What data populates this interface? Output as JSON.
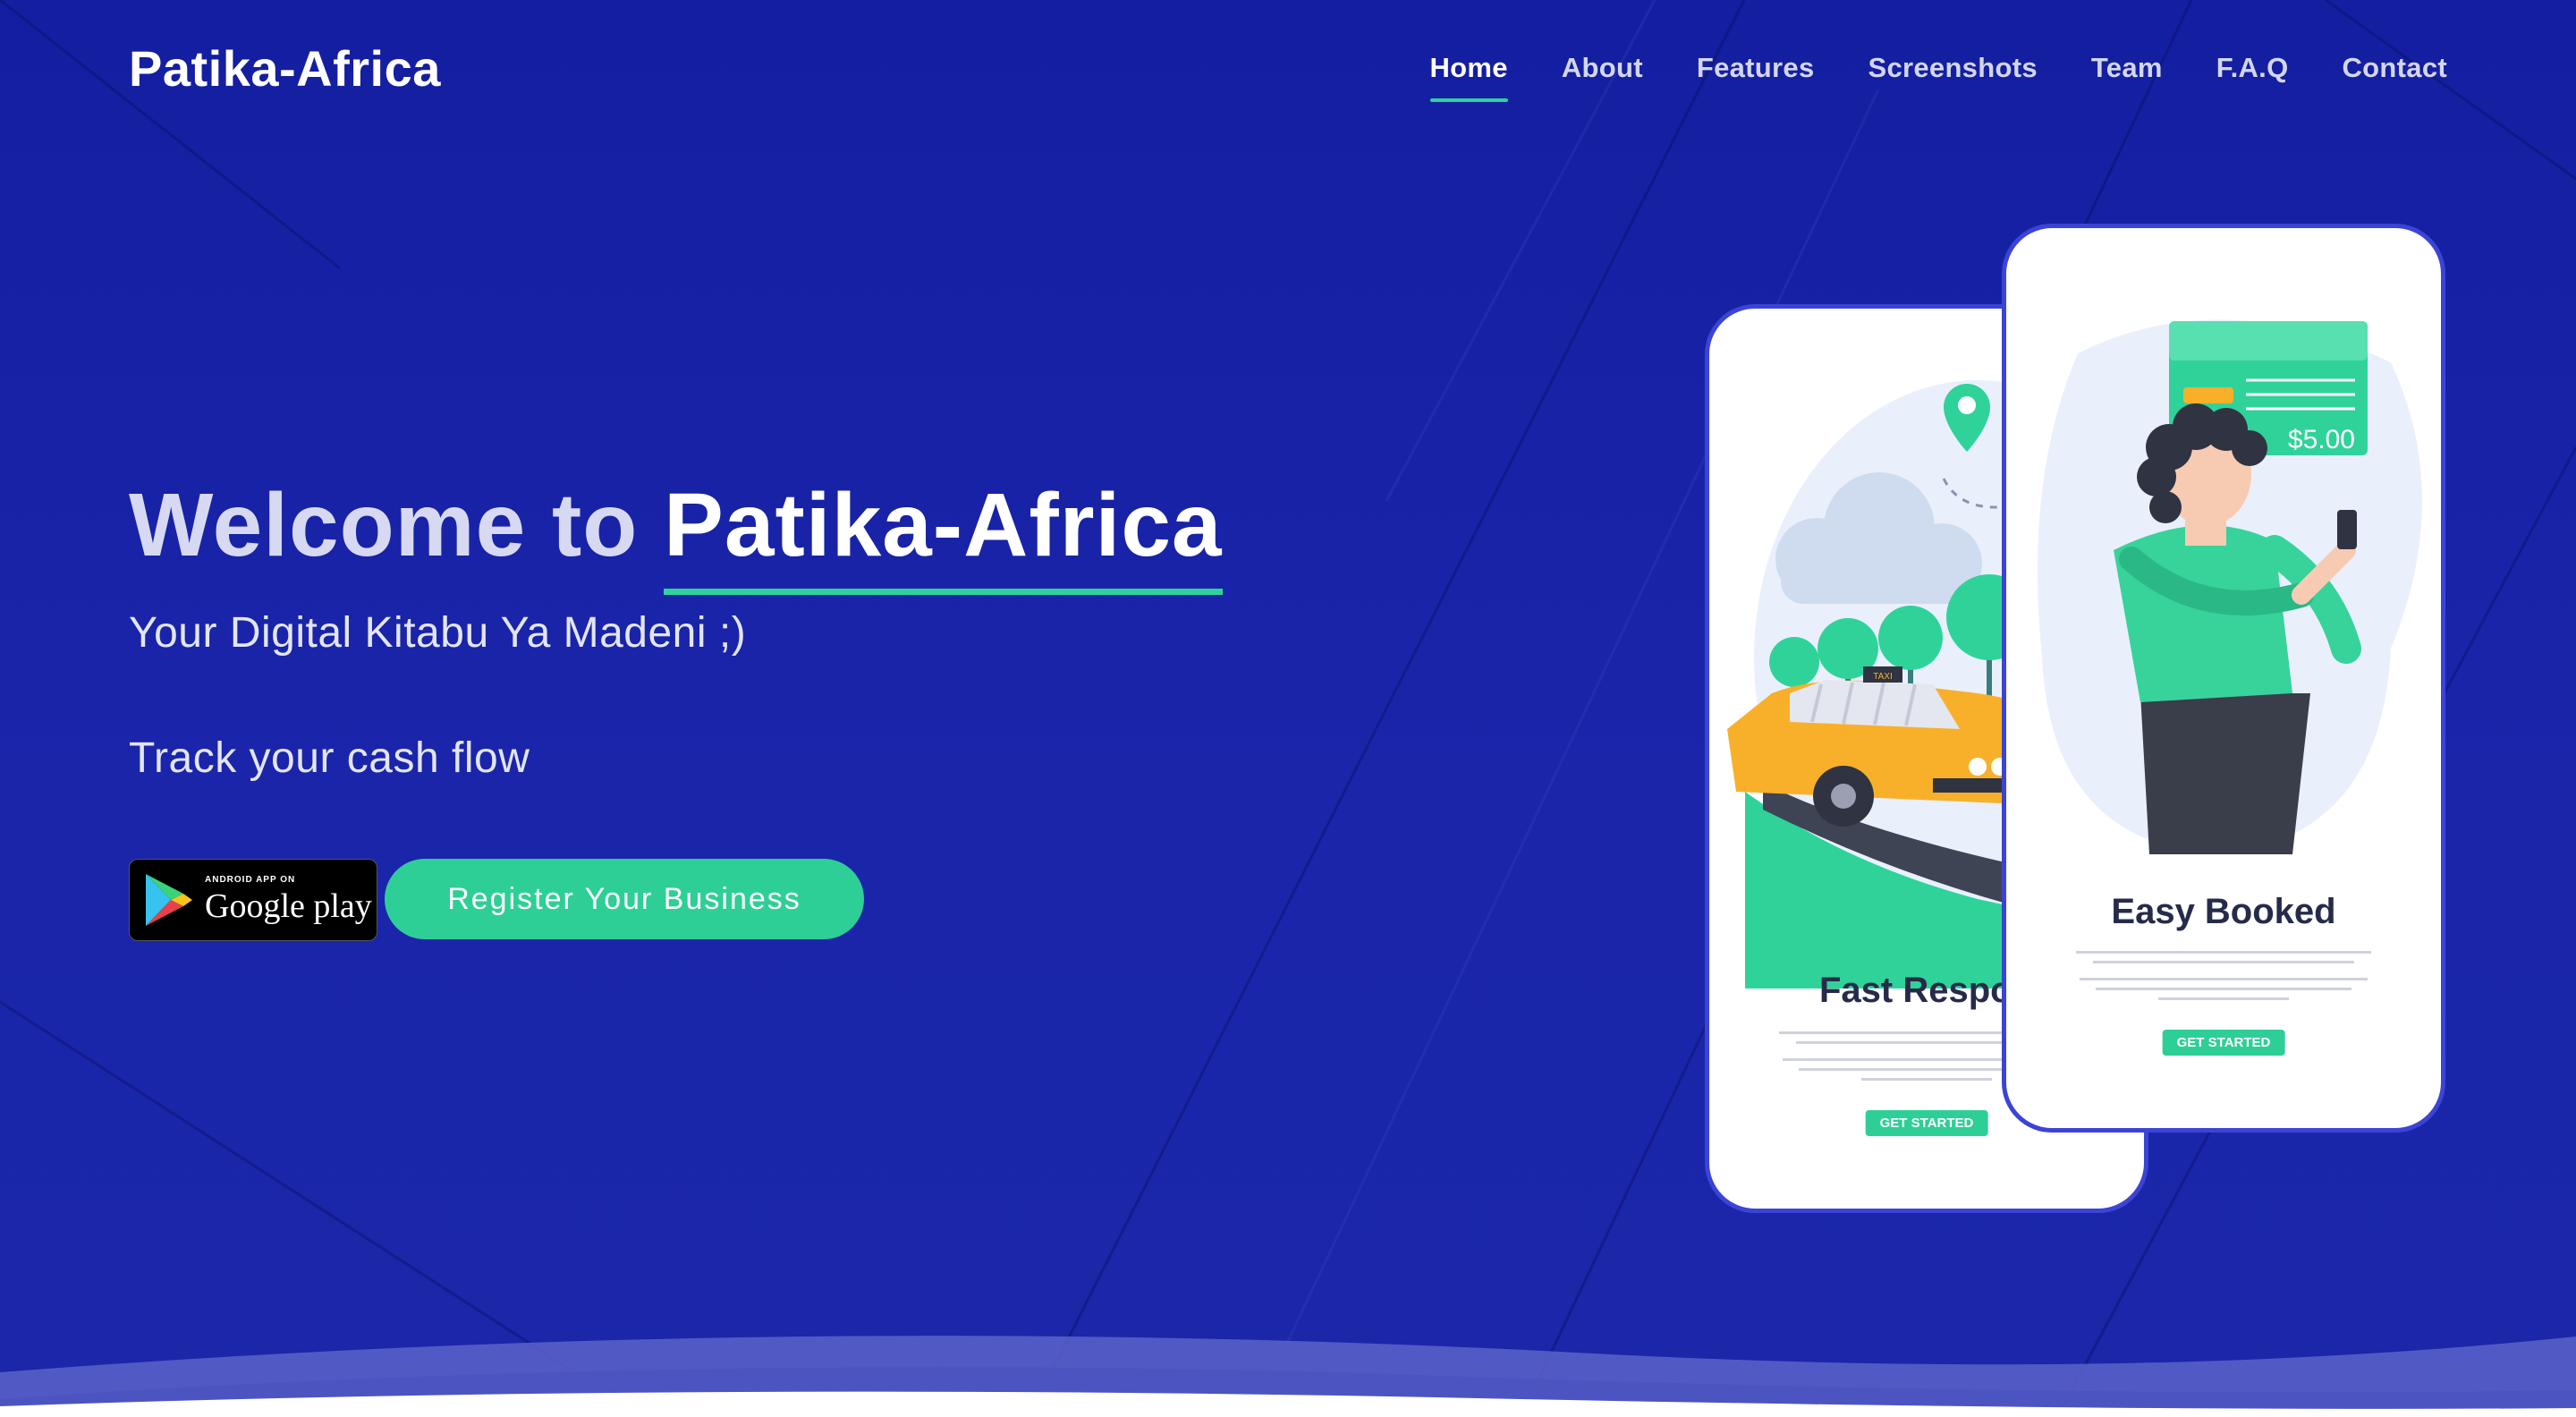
{
  "brand": {
    "name": "Patika-Africa"
  },
  "nav": {
    "items": [
      {
        "label": "Home",
        "active": true
      },
      {
        "label": "About"
      },
      {
        "label": "Features"
      },
      {
        "label": "Screenshots"
      },
      {
        "label": "Team"
      },
      {
        "label": "F.A.Q"
      },
      {
        "label": "Contact"
      }
    ]
  },
  "hero": {
    "title_prefix": "Welcome to ",
    "title_accent": "Patika-Africa",
    "subtitle": "Your Digital Kitabu Ya Madeni ;)",
    "tagline": "Track your cash flow",
    "google_play": {
      "small": "ANDROID APP ON",
      "big": "Google play"
    },
    "register_label": "Register Your Business"
  },
  "phones": {
    "back": {
      "title": "Fast Respon",
      "cta": "GET STARTED",
      "taxi_sign": "TAXI"
    },
    "front": {
      "title": "Easy Booked",
      "cta": "GET STARTED",
      "price": "$5.00"
    }
  },
  "colors": {
    "background": "#1a23a6",
    "accent": "#2fd39a",
    "phone_border": "#3b44d6"
  }
}
